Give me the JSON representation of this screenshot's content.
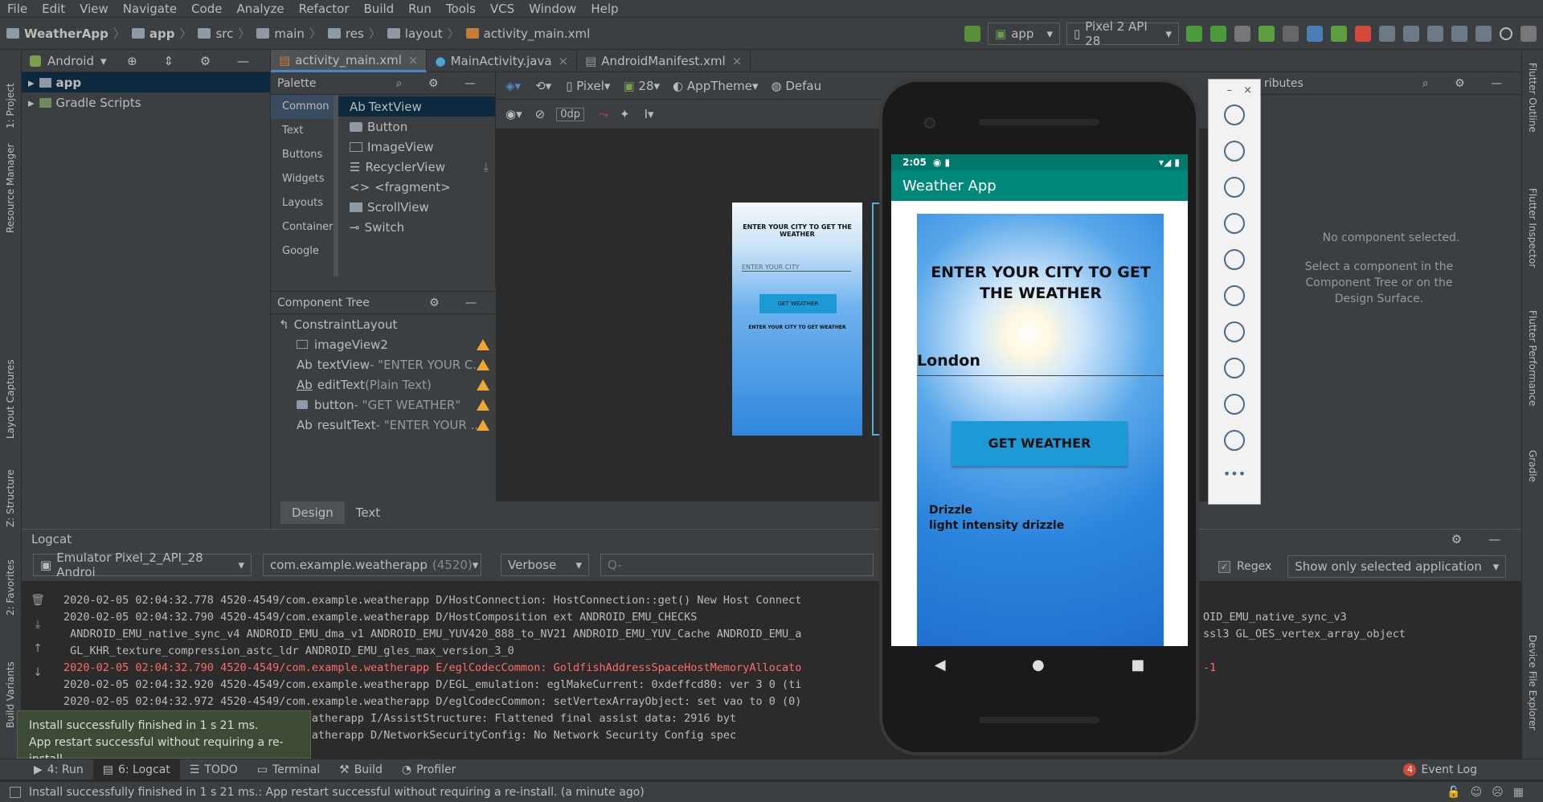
{
  "menu": [
    "File",
    "Edit",
    "View",
    "Navigate",
    "Code",
    "Analyze",
    "Refactor",
    "Build",
    "Run",
    "Tools",
    "VCS",
    "Window",
    "Help"
  ],
  "breadcrumb": [
    "WeatherApp",
    "app",
    "src",
    "main",
    "res",
    "layout",
    "activity_main.xml"
  ],
  "toolbar": {
    "run_config": "app",
    "device": "Pixel 2 API 28"
  },
  "project": {
    "view": "Android",
    "items": [
      "app",
      "Gradle Scripts"
    ]
  },
  "left_tool_labels": [
    "1: Project",
    "Resource Manager",
    "Layout Captures",
    "Z: Structure",
    "2: Favorites",
    "Build Variants"
  ],
  "right_tool_labels": [
    "Flutter Outline",
    "Flutter Inspector",
    "Flutter Performance",
    "Gradle",
    "Device File Explorer"
  ],
  "editor_tabs": [
    "activity_main.xml",
    "MainActivity.java",
    "AndroidManifest.xml"
  ],
  "design_toolbar": {
    "device": "Pixel",
    "api": "28",
    "theme": "AppTheme",
    "locale": "Defau",
    "margin": "0dp"
  },
  "palette": {
    "title": "Palette",
    "categories": [
      "Common",
      "Text",
      "Buttons",
      "Widgets",
      "Layouts",
      "Container",
      "Google"
    ],
    "items": [
      {
        "label": "TextView",
        "prefix": "Ab"
      },
      {
        "label": "Button",
        "prefix": ""
      },
      {
        "label": "ImageView",
        "prefix": ""
      },
      {
        "label": "RecyclerView",
        "prefix": ""
      },
      {
        "label": "<fragment>",
        "prefix": "<>"
      },
      {
        "label": "ScrollView",
        "prefix": ""
      },
      {
        "label": "Switch",
        "prefix": ""
      }
    ]
  },
  "component_tree": {
    "title": "Component Tree",
    "root": "ConstraintLayout",
    "rows": [
      {
        "prefix": "",
        "name": "imageView2",
        "detail": ""
      },
      {
        "prefix": "Ab",
        "name": "textView",
        "detail": "- \"ENTER YOUR C..."
      },
      {
        "prefix": "Ab",
        "name": "editText",
        "detail": "(Plain Text)"
      },
      {
        "prefix": "",
        "name": "button",
        "detail": "- \"GET WEATHER\""
      },
      {
        "prefix": "Ab",
        "name": "resultText",
        "detail": "- \"ENTER YOUR ..."
      }
    ]
  },
  "preview": {
    "heading": "ENTER YOUR CITY TO GET THE WEATHER",
    "hint": "ENTER YOUR CITY",
    "button": "GET WEATHER",
    "result": "ENTER YOUR CITY TO GET WEATHER"
  },
  "design_tabs": [
    "Design",
    "Text"
  ],
  "attributes": {
    "title": "ributes",
    "empty": "No component selected.",
    "hint": "Select a component in the Component Tree or on the Design Surface."
  },
  "phone": {
    "time": "2:05",
    "app_title": "Weather App",
    "heading": "ENTER YOUR CITY TO GET THE WEATHER",
    "city": "London",
    "button": "GET WEATHER",
    "result_line1": "Drizzle",
    "result_line2": "light intensity drizzle"
  },
  "logcat": {
    "title": "Logcat",
    "device": "Emulator Pixel_2_API_28 Androi",
    "process": "com.example.weatherapp",
    "process_pid": "(4520)",
    "level": "Verbose",
    "search_placeholder": "Q-",
    "regex": "Regex",
    "filter": "Show only selected application",
    "lines": [
      {
        "text": "2020-02-05 02:04:32.778 4520-4549/com.example.weatherapp D/HostConnection: HostConnection::get() New Host Connect",
        "err": false
      },
      {
        "text": "2020-02-05 02:04:32.790 4520-4549/com.example.weatherapp D/HostComposition ext ANDROID_EMU_CHECKS",
        "err": false
      },
      {
        "text": " ANDROID_EMU_native_sync_v4 ANDROID_EMU_dma_v1 ANDROID_EMU_YUV420_888_to_NV21 ANDROID_EMU_YUV_Cache ANDROID_EMU_a",
        "err": false
      },
      {
        "text": " GL_KHR_texture_compression_astc_ldr ANDROID_EMU_gles_max_version_3_0",
        "err": false
      },
      {
        "text": "2020-02-05 02:04:32.790 4520-4549/com.example.weatherapp E/eglCodecCommon: GoldfishAddressSpaceHostMemoryAllocato",
        "err": true
      },
      {
        "text": "2020-02-05 02:04:32.920 4520-4549/com.example.weatherapp D/EGL_emulation: eglMakeCurrent: 0xdeffcd80: ver 3 0 (ti",
        "err": false
      },
      {
        "text": "2020-02-05 02:04:32.972 4520-4549/com.example.weatherapp D/eglCodecCommon: setVertexArrayObject: set vao to 0 (0)",
        "err": false
      },
      {
        "text": "                        com.example.weatherapp I/AssistStructure: Flattened final assist data: 2916 byt",
        "err": false
      },
      {
        "text": "                        com.example.weatherapp D/NetworkSecurityConfig: No Network Security Config spec",
        "err": false
      }
    ],
    "right_fragments": [
      "OID_EMU_native_sync_v3",
      "ssl3 GL_OES_vertex_array_object",
      "-1"
    ]
  },
  "toast": {
    "line1": "Install successfully finished in 1 s 21 ms.",
    "line2": "App restart successful without requiring a re-install."
  },
  "bottom_tabs": [
    "4: Run",
    "6: Logcat",
    "TODO",
    "Terminal",
    "Build",
    "Profiler"
  ],
  "event_log": {
    "count": "4",
    "label": "Event Log"
  },
  "status": "Install successfully finished in 1 s 21 ms.: App restart successful without requiring a re-install. (a minute ago)",
  "colors": {
    "accent": "#4a88c7",
    "teal": "#00897b",
    "button": "#1c9ad6",
    "warn": "#f0a732",
    "error": "#ff6b68"
  }
}
